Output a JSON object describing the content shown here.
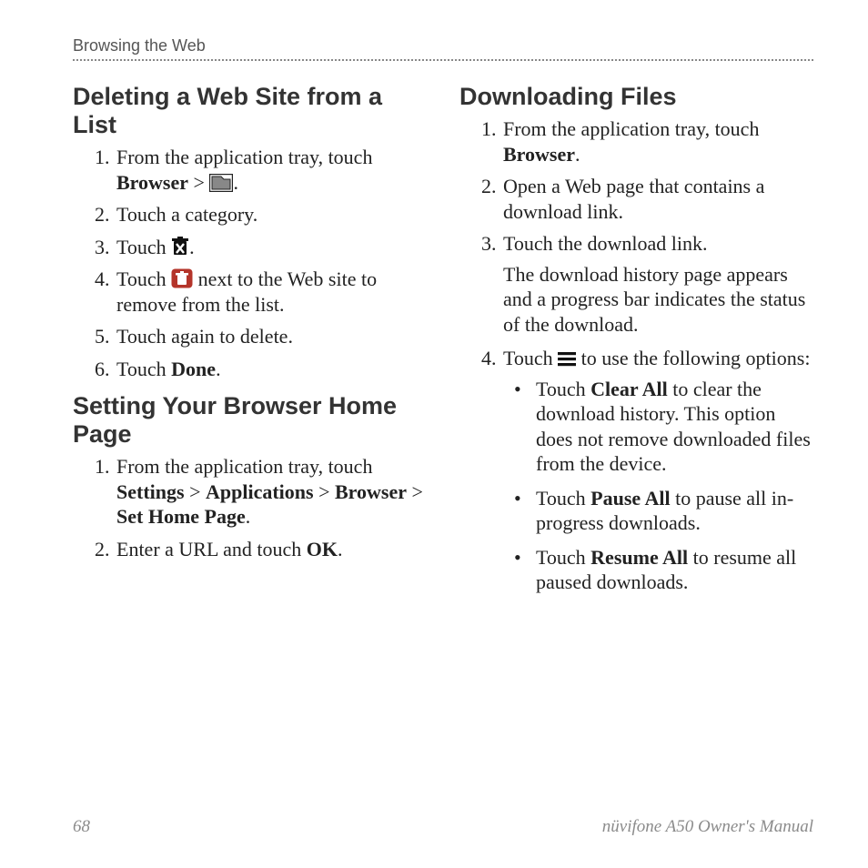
{
  "header": {
    "section_title": "Browsing the Web"
  },
  "footer": {
    "page_number": "68",
    "manual_title": "nüvifone A50 Owner's Manual"
  },
  "left": {
    "h1": "Deleting a Web Site from a List",
    "s1": {
      "li1_a": "From the application tray, touch ",
      "li1_b": "Browser",
      "li1_c": " > ",
      "li1_d": ".",
      "li2": "Touch a category.",
      "li3_a": "Touch ",
      "li3_b": ".",
      "li4_a": "Touch ",
      "li4_b": " next to the Web site to remove from the list.",
      "li5": "Touch again to delete.",
      "li6_a": "Touch ",
      "li6_b": "Done",
      "li6_c": "."
    },
    "h2": "Setting Your Browser Home Page",
    "s2": {
      "li1_a": "From the application tray, touch ",
      "li1_b": "Settings",
      "li1_c": " > ",
      "li1_d": "Applications",
      "li1_e": " > ",
      "li1_f": "Browser",
      "li1_g": " > ",
      "li1_h": "Set Home Page",
      "li1_i": ".",
      "li2_a": "Enter a URL and touch ",
      "li2_b": "OK",
      "li2_c": "."
    }
  },
  "right": {
    "h1": "Downloading Files",
    "s1": {
      "li1_a": "From the application tray, touch ",
      "li1_b": "Browser",
      "li1_c": ".",
      "li2": "Open a Web page that contains a download link.",
      "li3": "Touch the download link.",
      "li3_para": "The download history page appears and a progress bar indicates the status of the download.",
      "li4_a": "Touch ",
      "li4_b": " to use the following options:",
      "sub1_a": "Touch ",
      "sub1_b": "Clear All",
      "sub1_c": " to clear the download history. This option does not remove downloaded files from the device.",
      "sub2_a": "Touch ",
      "sub2_b": "Pause All",
      "sub2_c": " to pause all in-progress downloads.",
      "sub3_a": "Touch ",
      "sub3_b": "Resume All",
      "sub3_c": " to resume all paused downloads."
    }
  }
}
